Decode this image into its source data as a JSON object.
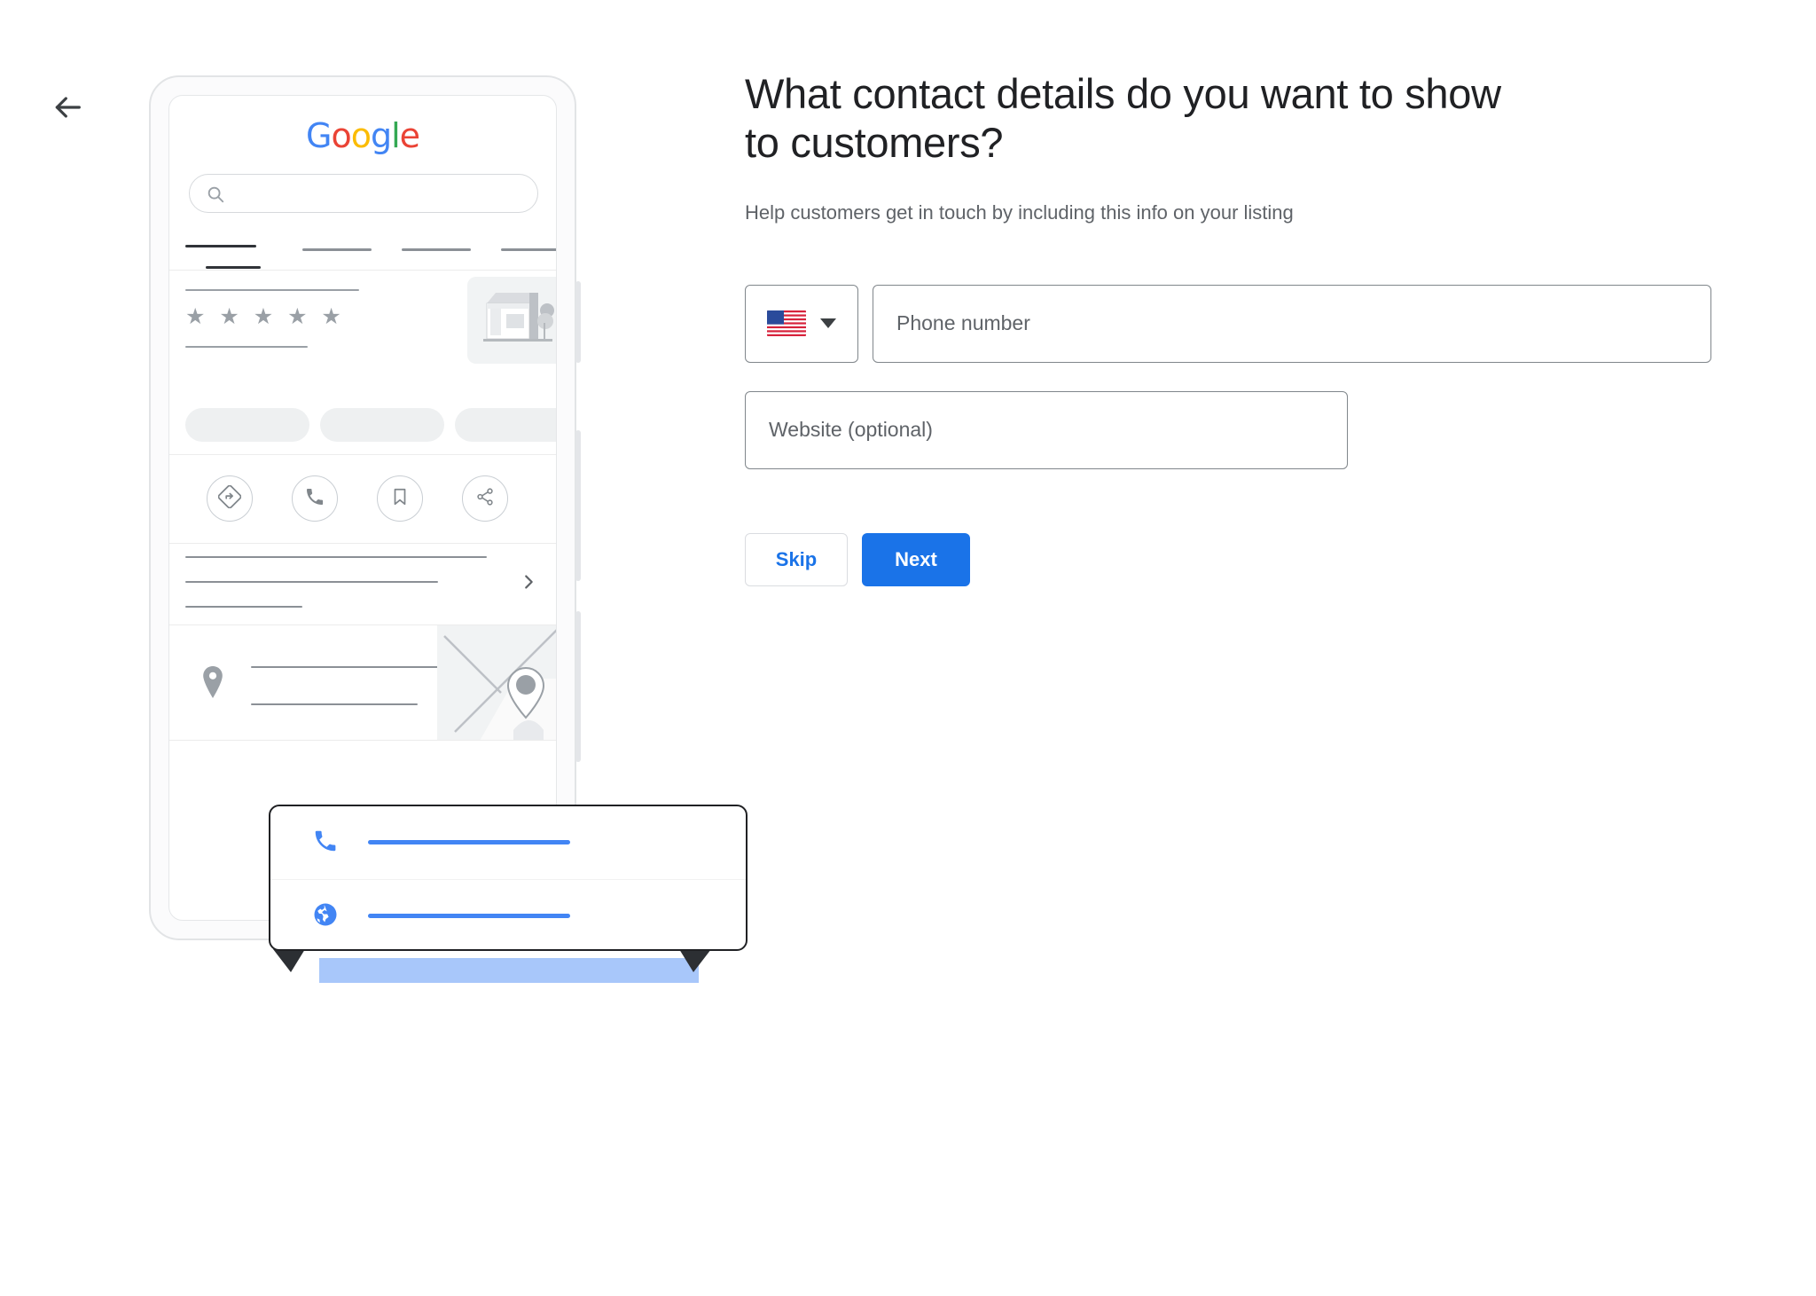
{
  "nav": {
    "back_icon": "arrow-left-icon"
  },
  "form": {
    "headline": "What contact details do you want to show to customers?",
    "subhead": "Help customers get in touch by including this info on your listing",
    "country": {
      "flag": "us-flag-icon",
      "caret": "chevron-down-icon"
    },
    "phone_placeholder": "Phone number",
    "website_placeholder": "Website (optional)",
    "skip_label": "Skip",
    "next_label": "Next",
    "accent_color": "#1a73e8",
    "border_color": "#80868b",
    "text_muted": "#5f6368"
  },
  "phone_mock": {
    "logo": {
      "letters": [
        "G",
        "o",
        "o",
        "g",
        "l",
        "e"
      ]
    },
    "search_icon": "search-icon",
    "tabs_count": 4,
    "active_tab_index": 0,
    "rating_stars": "★ ★ ★ ★ ★",
    "thumbnail_icon": "storefront-illustration",
    "chips_count": 4,
    "actions": [
      {
        "icon": "directions-icon"
      },
      {
        "icon": "phone-icon"
      },
      {
        "icon": "bookmark-icon"
      },
      {
        "icon": "share-icon"
      }
    ],
    "chevron_icon": "chevron-right-icon",
    "pin_icon": "location-pin-icon",
    "map_icon": "map-thumbnail",
    "highlight_card": {
      "rows": [
        {
          "icon": "phone-icon",
          "line_color": "#4285f4"
        },
        {
          "icon": "globe-icon",
          "line_color": "#4285f4"
        }
      ]
    },
    "highlight_band_color": "#a8c7fa"
  }
}
